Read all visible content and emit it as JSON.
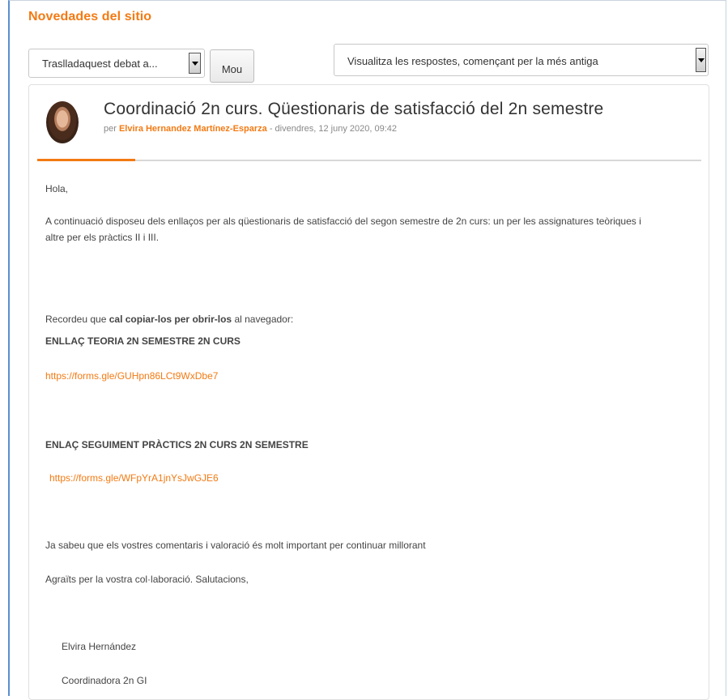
{
  "header": {
    "title": "Novedades del sitio"
  },
  "controls": {
    "move_select_value": "Traslladaquest debat a...",
    "move_button_label": "Mou",
    "order_select_value": "Visualitza les respostes, començant per la més antiga"
  },
  "post": {
    "title": "Coordinació 2n curs. Qüestionaris de satisfacció del 2n semestre",
    "by_prefix": "per",
    "author": "Elvira Hernandez Martínez-Esparza",
    "date_sep": " - ",
    "date": "divendres, 12 juny 2020, 09:42",
    "body": {
      "greeting": "Hola,",
      "intro": "A continuació disposeu dels enllaços per als qüestionaris de satisfacció del segon semestre de 2n curs: un per les assignatures teòriques i altre per els pràctics II i III.",
      "reminder_prefix": "Recordeu que ",
      "reminder_bold": "cal copiar-los per obrir-los",
      "reminder_suffix": " al navegador:",
      "heading_teoria": "ENLLAÇ TEORIA 2N SEMESTRE 2N CURS",
      "link_teoria": "https://forms.gle/GUHpn86LCt9WxDbe7",
      "heading_practics": "ENLAÇ SEGUIMENT PRÀCTICS 2N CURS 2N SEMESTRE",
      "link_practics": "https://forms.gle/WFpYrA1jnYsJwGJE6",
      "comments": "Ja sabeu que els vostres comentaris i valoració és molt important per continuar millorant",
      "thanks": "Agraïts per la vostra col·laboració.  Salutacions,",
      "signature_name": "Elvira Hernández",
      "signature_role": "Coordinadora 2n GI"
    }
  },
  "colors": {
    "accent": "#f37a13",
    "frame_border": "#5b8fd0"
  }
}
